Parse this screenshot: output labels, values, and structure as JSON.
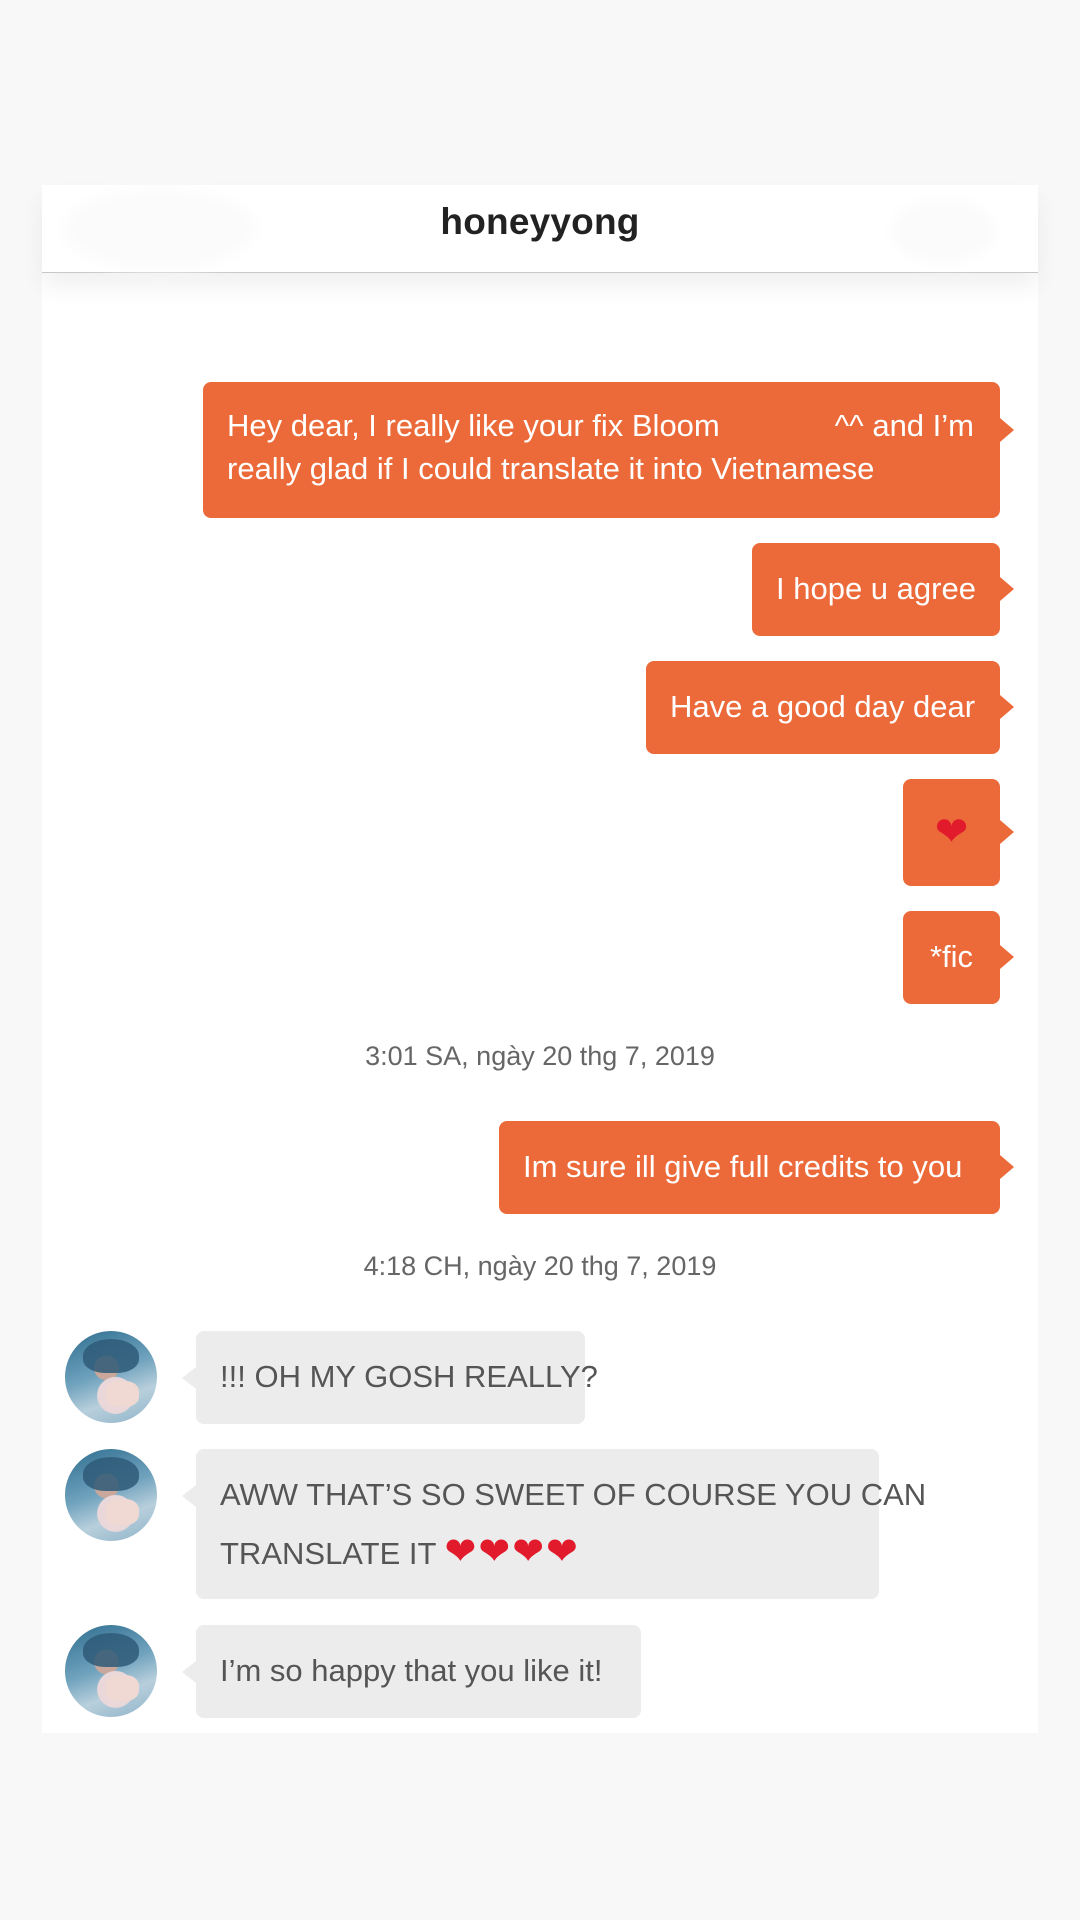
{
  "header": {
    "title": "honeyyong"
  },
  "messages": {
    "m1_line1": "Hey dear, I really like your fix Bloom",
    "m1_line1_end": "^^ and I’m",
    "m1_line2": "really glad if I could translate it into Vietnamese",
    "m2": "I hope u agree",
    "m3": "Have a good day dear",
    "m4": "❤",
    "m5": "*fic",
    "ts1": "3:01 SA, ngày 20 thg 7, 2019",
    "m6": "Im sure ill give full credits to you",
    "ts2": "4:18 CH, ngày 20 thg 7, 2019",
    "r1": "!!! OH MY GOSH REALLY?",
    "r2_line1": "AWW THAT’S SO SWEET OF COURSE YOU CAN",
    "r2_line2": "TRANSLATE IT",
    "r2_hearts": "❤❤❤❤",
    "r3": "I’m so happy that you like it!"
  },
  "colors": {
    "outgoing_bubble": "#ec6a39",
    "incoming_bubble": "#ececec",
    "heart": "#e21b2c"
  },
  "icons": {
    "avatar": "profile-photo",
    "heart": "red-heart-emoji"
  }
}
